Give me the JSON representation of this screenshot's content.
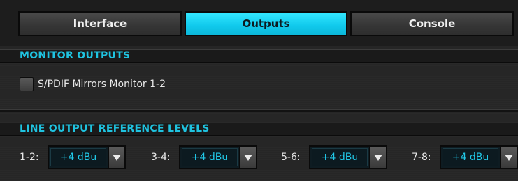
{
  "tabs": [
    {
      "label": "Interface",
      "active": false
    },
    {
      "label": "Outputs",
      "active": true
    },
    {
      "label": "Console",
      "active": false
    }
  ],
  "monitor_outputs": {
    "title": "MONITOR OUTPUTS",
    "checkbox_label": "S/PDIF Mirrors Monitor 1-2",
    "checked": false
  },
  "line_output": {
    "title": "LINE OUTPUT REFERENCE LEVELS",
    "channels": [
      {
        "label": "1-2:",
        "value": "+4 dBu"
      },
      {
        "label": "3-4:",
        "value": "+4 dBu"
      },
      {
        "label": "5-6:",
        "value": "+4 dBu"
      },
      {
        "label": "7-8:",
        "value": "+4 dBu"
      }
    ]
  },
  "colors": {
    "accent": "#1fc3e0",
    "active_tab": "#1fd6f5",
    "background": "#262626"
  }
}
